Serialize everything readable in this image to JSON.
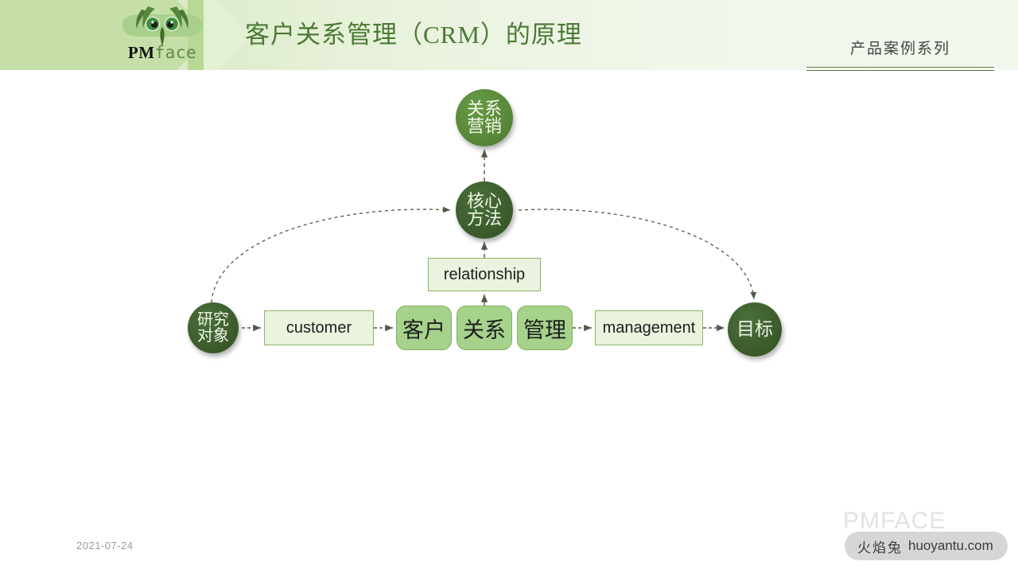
{
  "header": {
    "logo": {
      "pm": "PM",
      "face": "face",
      "icon": "mantis-face-logo"
    },
    "title": "客户关系管理（CRM）的原理",
    "subtitle": "产品案例系列",
    "colors": {
      "band_light": "#e7f1d9",
      "chevron": "#c6dfa8",
      "title_green": "#4a7a34"
    }
  },
  "diagram": {
    "nodes": {
      "relationship_marketing": {
        "line1": "关系",
        "line2": "营销",
        "shape": "circle",
        "fill": "#59883a"
      },
      "core_method": {
        "line1": "核心",
        "line2": "方法",
        "shape": "circle",
        "fill": "#3c5c2c"
      },
      "research_object": {
        "line1": "研究",
        "line2": "对象",
        "shape": "circle",
        "fill": "#3c5c2c"
      },
      "goal": {
        "label": "目标",
        "shape": "circle",
        "fill": "#3c5c2c"
      },
      "relationship_box": {
        "label": "relationship",
        "shape": "rect",
        "fill": "#eaf3de"
      },
      "customer_box": {
        "label": "customer",
        "shape": "rect",
        "fill": "#eaf3de"
      },
      "management_box": {
        "label": "management",
        "shape": "rect",
        "fill": "#eaf3de"
      },
      "kehu_box": {
        "label": "客户",
        "shape": "rounded-rect",
        "fill": "#a6d28b"
      },
      "guanxi_box": {
        "label": "关系",
        "shape": "rounded-rect",
        "fill": "#a6d28b"
      },
      "guanli_box": {
        "label": "管理",
        "shape": "rounded-rect",
        "fill": "#a6d28b"
      }
    }
  },
  "footer": {
    "date": "2021-07-24",
    "watermark_logo": "PMFACE",
    "watermark_cn": "火焰兔",
    "watermark_url": "huoyantu.com"
  }
}
